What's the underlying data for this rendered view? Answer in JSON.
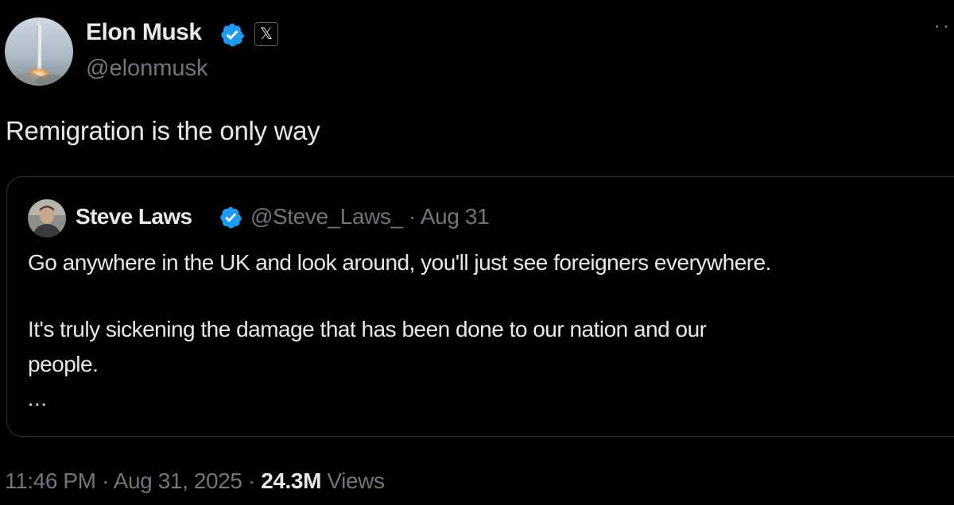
{
  "author": {
    "name": "Elon Musk",
    "handle": "@elonmusk",
    "affiliate_badge": "𝕏"
  },
  "post": {
    "text": "Remigration is the only way"
  },
  "quoted": {
    "name": "Steve Laws",
    "handle": "@Steve_Laws_",
    "separator": " · ",
    "date": "Aug 31",
    "lines": [
      "Go anywhere in the UK and look around, you'll just see foreigners everywhere.",
      "It's truly sickening the damage that has been done to our nation and our",
      "people.",
      "..."
    ]
  },
  "meta": {
    "time": "11:46 PM",
    "separator1": " · ",
    "date": "Aug 31, 2025",
    "separator2": " · ",
    "views_count": "24.3M",
    "views_label": " Views"
  },
  "icons": {
    "verified": "verified-badge-icon",
    "more": "more-options-icon",
    "affiliate": "x-logo-icon"
  },
  "colors": {
    "background": "#000000",
    "text": "#e7e9ea",
    "muted": "#71767b",
    "verified": "#1d9bf0",
    "border": "#2f3336"
  }
}
